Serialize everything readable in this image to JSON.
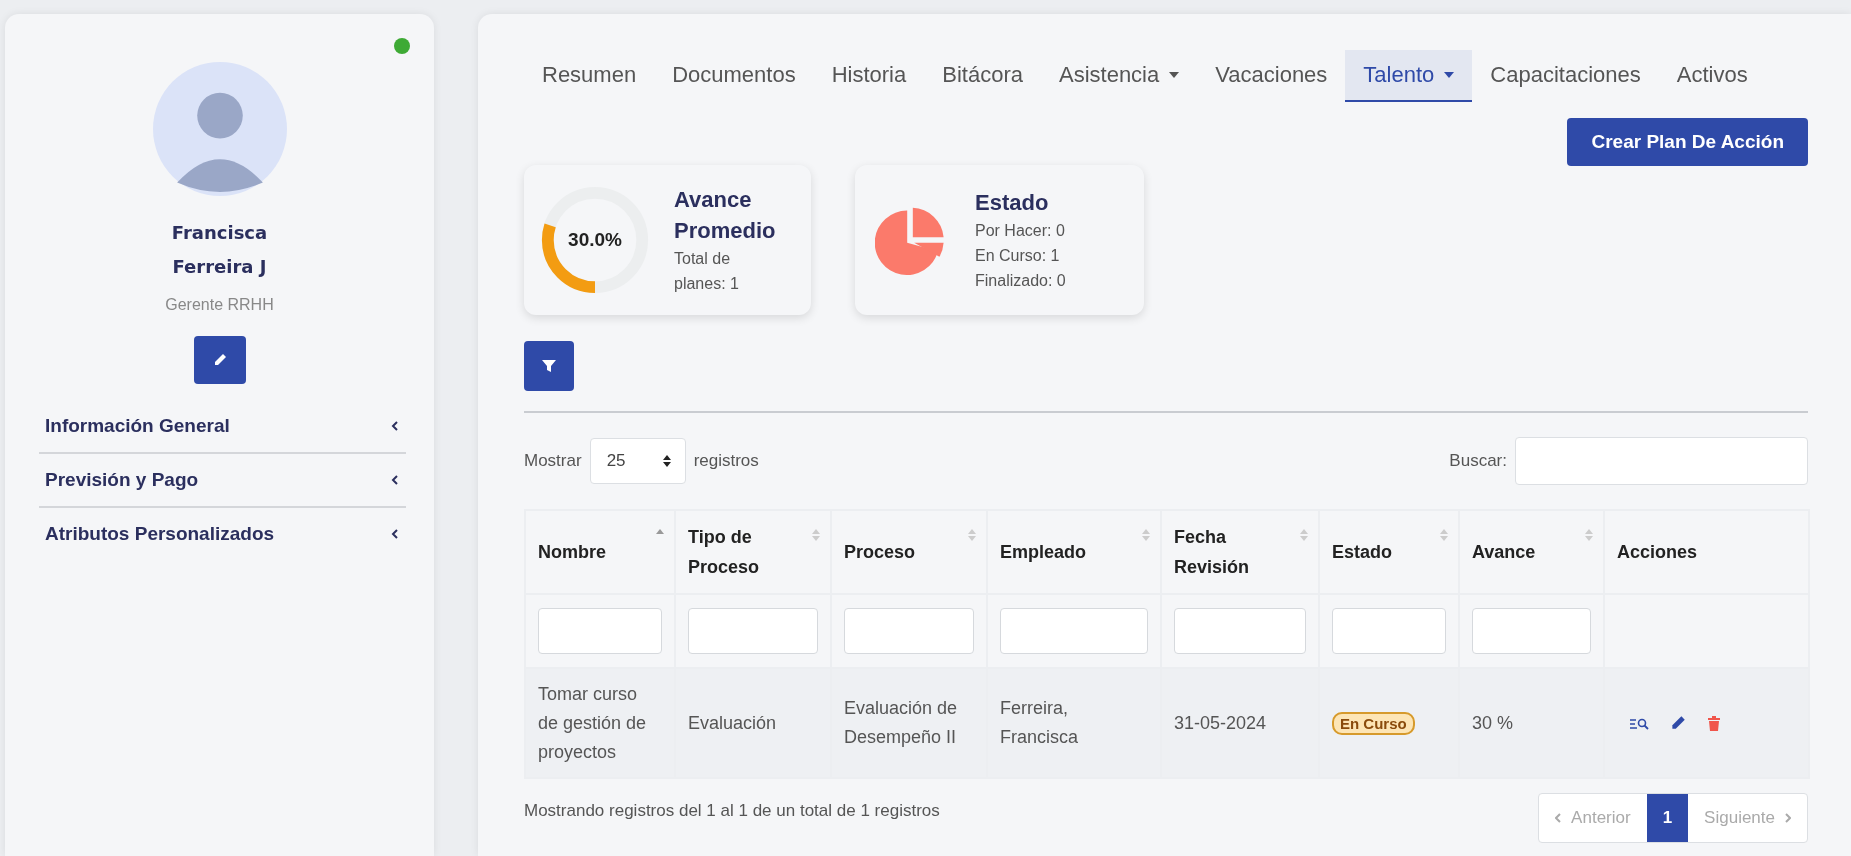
{
  "profile": {
    "name": "Francisca\nFerreira J",
    "role": "Gerente RRHH"
  },
  "accordion": [
    {
      "label": "Información General",
      "expanded": false
    },
    {
      "label": "Previsión y Pago",
      "expanded": false
    },
    {
      "label": "Atributos Personalizados",
      "expanded": false
    }
  ],
  "tabs": [
    {
      "label": "Resumen",
      "selected": false,
      "dropdown": false
    },
    {
      "label": "Documentos",
      "selected": false,
      "dropdown": false
    },
    {
      "label": "Historia",
      "selected": false,
      "dropdown": false
    },
    {
      "label": "Bitácora",
      "selected": false,
      "dropdown": false
    },
    {
      "label": "Asistencia",
      "selected": false,
      "dropdown": true
    },
    {
      "label": "Vacaciones",
      "selected": false,
      "dropdown": false
    },
    {
      "label": "Talento",
      "selected": true,
      "dropdown": true
    },
    {
      "label": "Capacitaciones",
      "selected": false,
      "dropdown": false
    },
    {
      "label": "Activos",
      "selected": false,
      "dropdown": false
    }
  ],
  "create_button": "Crear Plan De Acción",
  "progress_card": {
    "value": "30.0%",
    "level": 0.3,
    "title": "Avance\nPromedio",
    "subtitle": "Total de\nplanes: 1"
  },
  "status_card": {
    "title": "Estado",
    "lines": [
      "Por Hacer: 0",
      "En Curso: 1",
      "Finalizado: 0"
    ]
  },
  "length_control": {
    "prefix": "Mostrar",
    "value": "25",
    "suffix": "registros"
  },
  "search": {
    "label": "Buscar:"
  },
  "table": {
    "columns": [
      {
        "label": "Nombre",
        "sorted": true,
        "filter": true
      },
      {
        "label": "Tipo de Proceso",
        "sortable": true,
        "sorted": false,
        "filter": true
      },
      {
        "label": "Proceso",
        "sortable": true,
        "sorted": false,
        "filter": true
      },
      {
        "label": "Empleado",
        "sortable": true,
        "sorted": false,
        "filter": true
      },
      {
        "label": "Fecha Revisión",
        "sortable": true,
        "sorted": false,
        "filter": true
      },
      {
        "label": "Estado",
        "sortable": true,
        "sorted": false,
        "filter": true
      },
      {
        "label": "Avance",
        "sortable": true,
        "sorted": false,
        "filter": true
      },
      {
        "label": "Acciones",
        "sortable": false,
        "sorted": false,
        "filter": false
      }
    ],
    "rows": [
      {
        "cells": [
          {
            "kind": "text",
            "text": "Tomar curso de gestión de proyectos"
          },
          {
            "kind": "text",
            "text": "Evaluación"
          },
          {
            "kind": "text",
            "text": "Evaluación de Desempeño II"
          },
          {
            "kind": "text",
            "text": "Ferreira, Francisca"
          },
          {
            "kind": "text",
            "text": "31-05-2024"
          },
          {
            "kind": "badge",
            "text": "En Curso"
          },
          {
            "kind": "text",
            "text": "30 %"
          }
        ],
        "actions": [
          {
            "kind": "view"
          },
          {
            "kind": "edit"
          },
          {
            "kind": "delete"
          }
        ]
      }
    ]
  },
  "info": "Mostrando registros del 1 al 1 de un total de 1 registros",
  "pagination": [
    {
      "label": "Anterior",
      "kind": "prev",
      "selected": false,
      "disabled": true
    },
    {
      "label": "1",
      "kind": "page",
      "selected": true,
      "disabled": false
    },
    {
      "label": "Siguiente",
      "kind": "next",
      "selected": false,
      "disabled": true
    }
  ]
}
